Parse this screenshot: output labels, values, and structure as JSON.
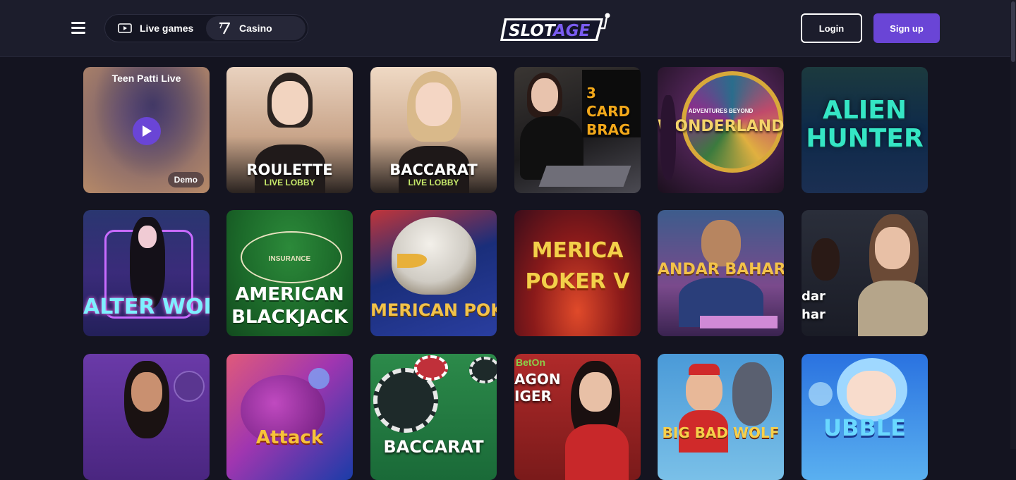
{
  "header": {
    "nav": {
      "live_label": "Live games",
      "casino_label": "Casino"
    },
    "logo_text": "SLOTAGE",
    "login_label": "Login",
    "signup_label": "Sign up",
    "accent": "#6a45d6"
  },
  "featured_tile": {
    "name": "Teen Patti Live",
    "badge": "Demo"
  },
  "games": [
    {
      "title": "ROULETTE",
      "sub": "LIVE LOBBY"
    },
    {
      "title": "BACCARAT",
      "sub": "LIVE LOBBY"
    },
    {
      "title": "3 CARD BRAG"
    },
    {
      "title": "WONDERLAND",
      "sub": "ADVENTURES BEYOND"
    },
    {
      "title": "ALIEN HUNTER"
    },
    {
      "title": "ALTER WORLD"
    },
    {
      "title": "AMERICAN BLACKJACK",
      "sub": "INSURANCE"
    },
    {
      "title": "MERICAN POKE"
    },
    {
      "title": "MERICA POKER V"
    },
    {
      "title": "ANDAR BAHAR"
    },
    {
      "title": "dar har"
    },
    {
      "title": ""
    },
    {
      "title": "Attack"
    },
    {
      "title": "BACCARAT"
    },
    {
      "title": "AGON IGER",
      "sub": "BetOn"
    },
    {
      "title": "BIG BAD WOLF"
    },
    {
      "title": "UBBLE"
    }
  ]
}
